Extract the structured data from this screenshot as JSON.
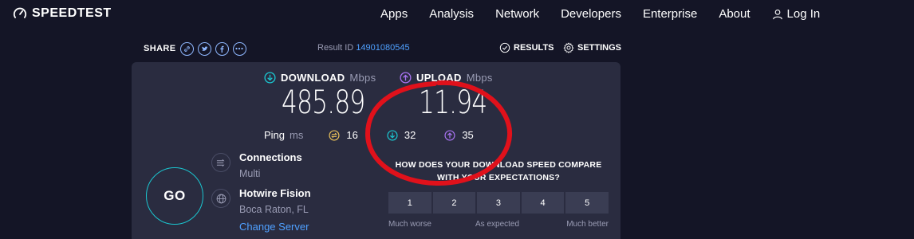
{
  "brand": {
    "name": "SPEEDTEST"
  },
  "nav": {
    "items": [
      "Apps",
      "Analysis",
      "Network",
      "Developers",
      "Enterprise",
      "About"
    ],
    "login": "Log In"
  },
  "share": {
    "label": "SHARE",
    "buttons": [
      "link-icon",
      "twitter-icon",
      "facebook-icon",
      "more-icon"
    ],
    "result_id_label": "Result ID",
    "result_id": "14901080545",
    "results": "RESULTS",
    "settings": "SETTINGS"
  },
  "metrics": {
    "download": {
      "label": "DOWNLOAD",
      "unit": "Mbps",
      "value": "485.89"
    },
    "upload": {
      "label": "UPLOAD",
      "unit": "Mbps",
      "value": "11.94"
    }
  },
  "ping": {
    "label": "Ping",
    "unit": "ms",
    "idle": "16",
    "download": "32",
    "upload": "35"
  },
  "go_label": "GO",
  "connections": {
    "title": "Connections",
    "value": "Multi"
  },
  "server": {
    "name": "Hotwire Fision",
    "location": "Boca Raton, FL",
    "change": "Change Server"
  },
  "survey": {
    "question": "HOW DOES YOUR DOWNLOAD SPEED COMPARE WITH YOUR EXPECTATIONS?",
    "options": [
      "1",
      "2",
      "3",
      "4",
      "5"
    ],
    "scale": [
      "Much worse",
      "As expected",
      "Much better"
    ]
  },
  "colors": {
    "background": "#141526",
    "panel": "#2a2c40",
    "download": "#1bc6d0",
    "upload": "#a873f1",
    "link": "#4fa0ff",
    "idle": "#e8c05a",
    "annotation": "#e0111b"
  }
}
